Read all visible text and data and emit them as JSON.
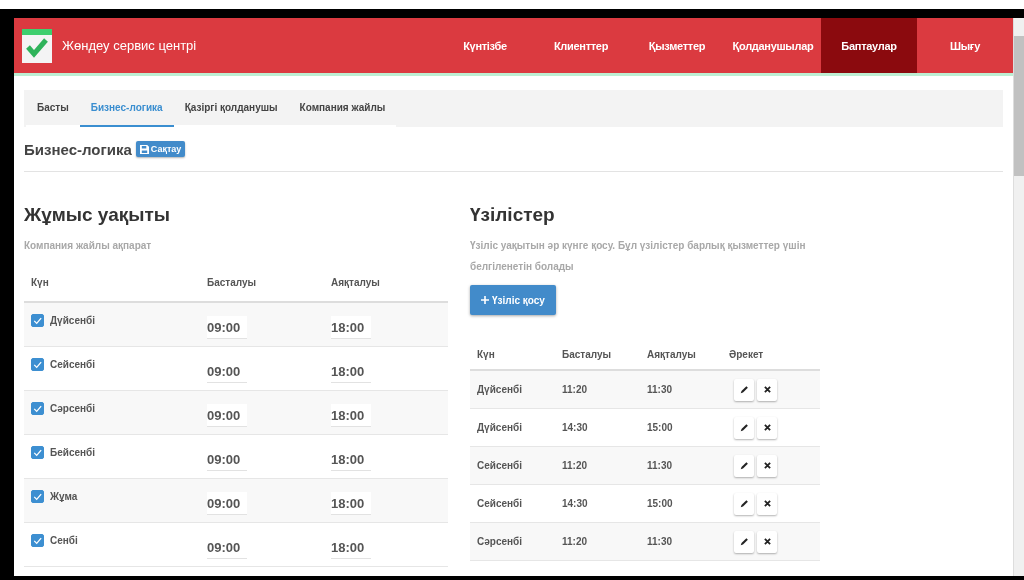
{
  "header": {
    "app_title": "Жөндеу сервис центрі",
    "nav": [
      {
        "label": "Күнтізбе",
        "selected": false
      },
      {
        "label": "Клиенттер",
        "selected": false
      },
      {
        "label": "Қызметтер",
        "selected": false
      },
      {
        "label": "Қолданушылар",
        "selected": false
      },
      {
        "label": "Баптаулар",
        "selected": true
      },
      {
        "label": "Шығу",
        "selected": false
      }
    ]
  },
  "tabs": [
    {
      "label": "Басты",
      "selected": false
    },
    {
      "label": "Бизнес-логика",
      "selected": true
    },
    {
      "label": "Қазіргі қолданушы",
      "selected": false
    },
    {
      "label": "Компания жайлы",
      "selected": false
    }
  ],
  "page_title": "Бизнес-логика",
  "save_button": "Сақтау",
  "work_hours": {
    "title": "Жұмыс уақыты",
    "subtitle": "Компания жайлы ақпарат",
    "columns": [
      "Күн",
      "Басталуы",
      "Аяқталуы"
    ],
    "rows": [
      {
        "day": "Дүйсенбі",
        "checked": true,
        "start": "09:00",
        "end": "18:00"
      },
      {
        "day": "Сейсенбі",
        "checked": true,
        "start": "09:00",
        "end": "18:00"
      },
      {
        "day": "Сәрсенбі",
        "checked": true,
        "start": "09:00",
        "end": "18:00"
      },
      {
        "day": "Бейсенбі",
        "checked": true,
        "start": "09:00",
        "end": "18:00"
      },
      {
        "day": "Жұма",
        "checked": true,
        "start": "09:00",
        "end": "18:00"
      },
      {
        "day": "Сенбі",
        "checked": true,
        "start": "09:00",
        "end": "18:00"
      }
    ]
  },
  "breaks": {
    "title": "Үзілістер",
    "description": "Үзіліс уақытын әр күнге қосу. Бұл үзілістер барлық қызметтер үшін белгіленетін болады",
    "add_button": "Үзіліс қосу",
    "columns": [
      "Күн",
      "Басталуы",
      "Аяқталуы",
      "Әрекет"
    ],
    "rows": [
      {
        "day": "Дүйсенбі",
        "start": "11:20",
        "end": "11:30"
      },
      {
        "day": "Дүйсенбі",
        "start": "14:30",
        "end": "15:00"
      },
      {
        "day": "Сейсенбі",
        "start": "11:20",
        "end": "11:30"
      },
      {
        "day": "Сейсенбі",
        "start": "14:30",
        "end": "15:00"
      },
      {
        "day": "Сәрсенбі",
        "start": "11:20",
        "end": "11:30"
      }
    ]
  }
}
